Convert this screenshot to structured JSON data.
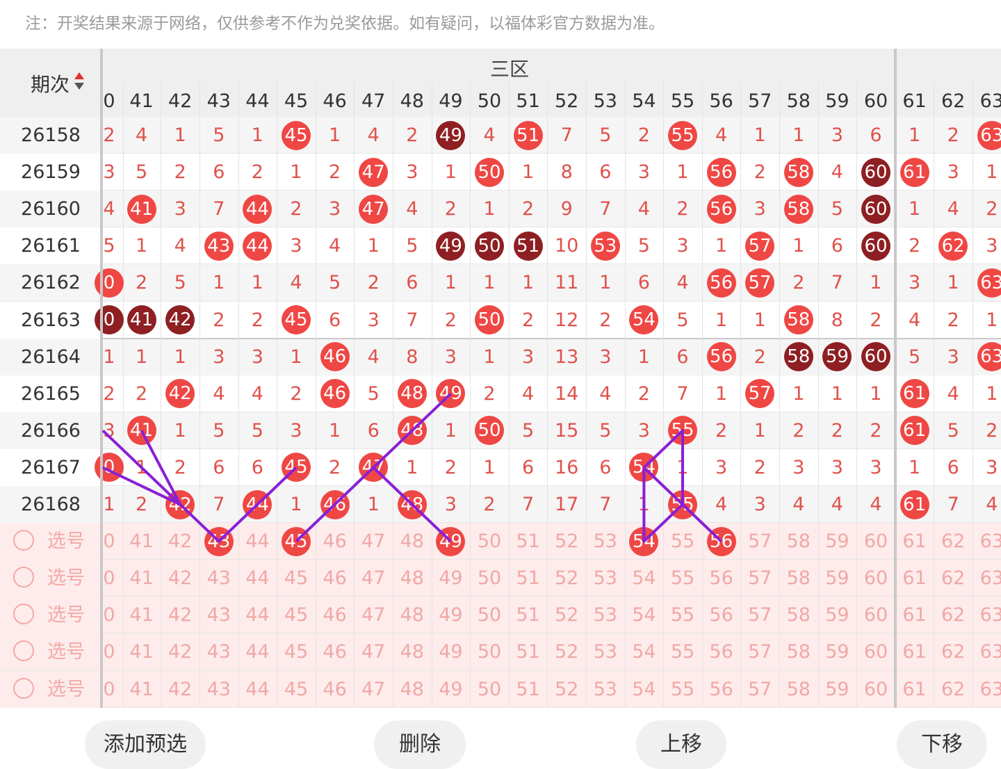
{
  "note": "注：开奖结果来源于网络，仅供参考不作为兑奖依据。如有疑问，以福体彩官方数据为准。",
  "header": {
    "period_label": "期次",
    "zone_label": "三区"
  },
  "columns": [
    "0",
    "41",
    "42",
    "43",
    "44",
    "45",
    "46",
    "47",
    "48",
    "49",
    "50",
    "51",
    "52",
    "53",
    "54",
    "55",
    "56",
    "57",
    "58",
    "59",
    "60",
    "61",
    "62",
    "63"
  ],
  "rows": [
    {
      "period": "26158",
      "cells": [
        "2",
        "4",
        "1",
        "5",
        "1",
        "45",
        "1",
        "4",
        "2",
        "49",
        "4",
        "51",
        "7",
        "5",
        "2",
        "55",
        "4",
        "1",
        "1",
        "3",
        "6",
        "1",
        "2",
        "63"
      ],
      "balls": {
        "5": "red",
        "9": "dark",
        "11": "red",
        "15": "red",
        "23": "red"
      }
    },
    {
      "period": "26159",
      "cells": [
        "3",
        "5",
        "2",
        "6",
        "2",
        "1",
        "2",
        "47",
        "3",
        "1",
        "50",
        "1",
        "8",
        "6",
        "3",
        "1",
        "56",
        "2",
        "58",
        "4",
        "60",
        "61",
        "3",
        "1"
      ],
      "balls": {
        "7": "red",
        "10": "red",
        "16": "red",
        "18": "red",
        "20": "dark",
        "21": "red"
      }
    },
    {
      "period": "26160",
      "cells": [
        "4",
        "41",
        "3",
        "7",
        "44",
        "2",
        "3",
        "47",
        "4",
        "2",
        "1",
        "2",
        "9",
        "7",
        "4",
        "2",
        "56",
        "3",
        "58",
        "5",
        "60",
        "1",
        "4",
        "2"
      ],
      "balls": {
        "1": "red",
        "4": "red",
        "7": "red",
        "16": "red",
        "18": "red",
        "20": "dark"
      }
    },
    {
      "period": "26161",
      "cells": [
        "5",
        "1",
        "4",
        "43",
        "44",
        "3",
        "4",
        "1",
        "5",
        "49",
        "50",
        "51",
        "10",
        "53",
        "5",
        "3",
        "1",
        "57",
        "1",
        "6",
        "60",
        "2",
        "62",
        "3"
      ],
      "balls": {
        "3": "red",
        "4": "red",
        "9": "dark",
        "10": "dark",
        "11": "dark",
        "13": "red",
        "17": "red",
        "20": "dark",
        "22": "red"
      }
    },
    {
      "period": "26162",
      "cells": [
        "0",
        "2",
        "5",
        "1",
        "1",
        "4",
        "5",
        "2",
        "6",
        "1",
        "1",
        "1",
        "11",
        "1",
        "6",
        "4",
        "56",
        "57",
        "2",
        "7",
        "1",
        "3",
        "1",
        "63"
      ],
      "balls": {
        "0": "red",
        "16": "red",
        "17": "red",
        "23": "red"
      }
    },
    {
      "period": "26163",
      "cells": [
        "0",
        "41",
        "42",
        "2",
        "2",
        "45",
        "6",
        "3",
        "7",
        "2",
        "50",
        "2",
        "12",
        "2",
        "54",
        "5",
        "1",
        "1",
        "58",
        "8",
        "2",
        "4",
        "2",
        "1"
      ],
      "balls": {
        "0": "dark",
        "1": "dark",
        "2": "dark",
        "5": "red",
        "10": "red",
        "14": "red",
        "18": "red"
      }
    },
    {
      "period": "26164",
      "cells": [
        "1",
        "1",
        "1",
        "3",
        "3",
        "1",
        "46",
        "4",
        "8",
        "3",
        "1",
        "3",
        "13",
        "3",
        "1",
        "6",
        "56",
        "2",
        "58",
        "59",
        "60",
        "5",
        "3",
        "63"
      ],
      "balls": {
        "6": "red",
        "16": "red",
        "18": "dark",
        "19": "dark",
        "20": "dark",
        "23": "red"
      }
    },
    {
      "period": "26165",
      "cells": [
        "2",
        "2",
        "42",
        "4",
        "4",
        "2",
        "46",
        "5",
        "48",
        "49",
        "2",
        "4",
        "14",
        "4",
        "2",
        "7",
        "1",
        "57",
        "1",
        "1",
        "1",
        "61",
        "4",
        "1"
      ],
      "balls": {
        "2": "red",
        "6": "red",
        "8": "red",
        "9": "red",
        "17": "red",
        "21": "red"
      }
    },
    {
      "period": "26166",
      "cells": [
        "3",
        "41",
        "1",
        "5",
        "5",
        "3",
        "1",
        "6",
        "48",
        "1",
        "50",
        "5",
        "15",
        "5",
        "3",
        "55",
        "2",
        "1",
        "2",
        "2",
        "2",
        "61",
        "5",
        "2"
      ],
      "balls": {
        "1": "red",
        "8": "red",
        "10": "red",
        "15": "red",
        "21": "red"
      }
    },
    {
      "period": "26167",
      "cells": [
        "0",
        "1",
        "2",
        "6",
        "6",
        "45",
        "2",
        "47",
        "1",
        "2",
        "1",
        "6",
        "16",
        "6",
        "54",
        "1",
        "3",
        "2",
        "3",
        "3",
        "3",
        "1",
        "6",
        "3"
      ],
      "balls": {
        "0": "red",
        "5": "red",
        "7": "red",
        "14": "red"
      }
    },
    {
      "period": "26168",
      "cells": [
        "1",
        "2",
        "42",
        "7",
        "44",
        "1",
        "46",
        "1",
        "48",
        "3",
        "2",
        "7",
        "17",
        "7",
        "1",
        "55",
        "4",
        "3",
        "4",
        "4",
        "4",
        "61",
        "7",
        "4"
      ],
      "balls": {
        "2": "red",
        "4": "red",
        "6": "red",
        "8": "red",
        "15": "red",
        "21": "red"
      }
    }
  ],
  "preselect": {
    "label": "选号",
    "rows": [
      {
        "balls": [
          "43",
          "45",
          "49",
          "54",
          "56"
        ]
      },
      {
        "balls": []
      },
      {
        "balls": []
      },
      {
        "balls": []
      },
      {
        "balls": []
      }
    ]
  },
  "trend_lines": [
    [
      [
        "0",
        "26166"
      ],
      [
        "43",
        "pre1"
      ],
      [
        "45",
        "26167"
      ]
    ],
    [
      [
        "0",
        "26167"
      ],
      [
        "42",
        "26168"
      ]
    ],
    [
      [
        "41",
        "26166"
      ],
      [
        "42",
        "26168"
      ]
    ],
    [
      [
        "45",
        "pre1"
      ],
      [
        "49",
        "26165"
      ]
    ],
    [
      [
        "47",
        "26167"
      ],
      [
        "49",
        "pre1"
      ]
    ],
    [
      [
        "54",
        "26167"
      ],
      [
        "55",
        "26166"
      ],
      [
        "55",
        "26168"
      ],
      [
        "54",
        "pre1"
      ],
      [
        "54",
        "26167"
      ]
    ],
    [
      [
        "54",
        "26167"
      ],
      [
        "56",
        "pre1"
      ]
    ]
  ],
  "colors": {
    "ball_red": "#ef4744",
    "ball_dark": "#8e1f22",
    "miss_text": "#e0514b",
    "trend_line": "#8a1fd6"
  },
  "buttons": {
    "add": "添加预选",
    "delete": "删除",
    "up": "上移",
    "down": "下移"
  }
}
